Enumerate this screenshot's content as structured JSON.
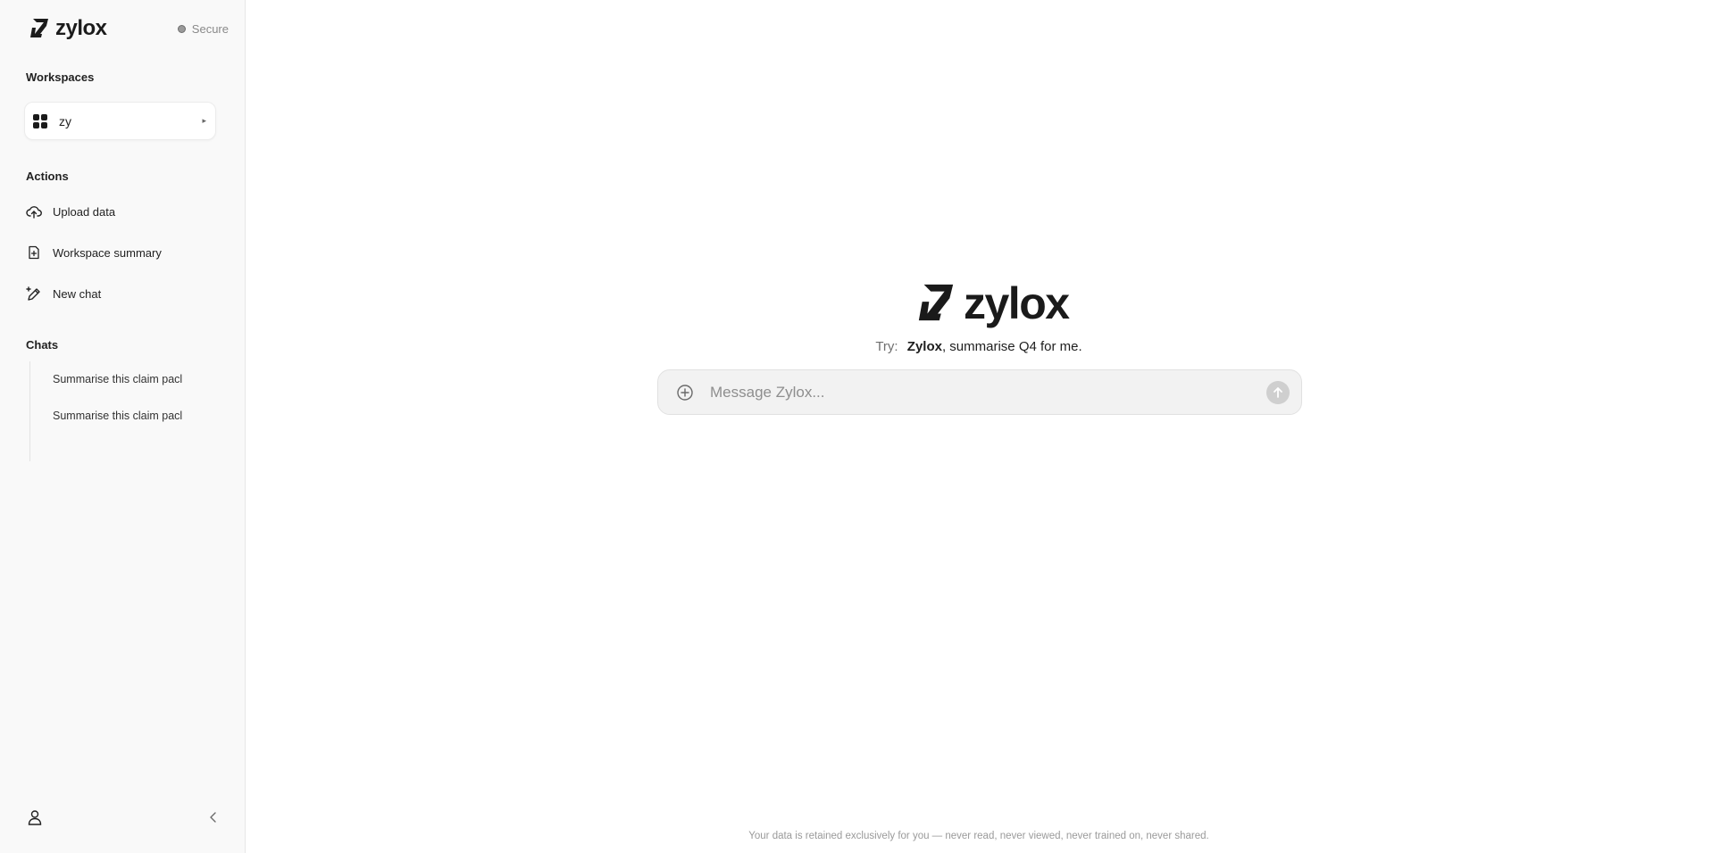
{
  "brand": {
    "name": "zylox"
  },
  "status": {
    "label": "Secure"
  },
  "sidebar": {
    "workspaces_label": "Workspaces",
    "workspace": {
      "name": "zy"
    },
    "actions_label": "Actions",
    "actions": [
      {
        "label": "Upload data",
        "icon": "cloud-upload-icon"
      },
      {
        "label": "Workspace summary",
        "icon": "file-plus-icon"
      },
      {
        "label": "New chat",
        "icon": "pen-sparkle-icon"
      }
    ],
    "chats_label": "Chats",
    "chats": [
      {
        "label": "Summarise this claim pacl"
      },
      {
        "label": "Summarise this claim pacl"
      }
    ]
  },
  "main": {
    "hero_name": "zylox",
    "try": {
      "label": "Try:",
      "brand": "Zylox",
      "rest": ", summarise Q4 for me."
    },
    "composer": {
      "placeholder": "Message Zylox..."
    },
    "footer": "Your data is retained exclusively for you — never read, never viewed, never trained on, never shared."
  },
  "colors": {
    "sidebar_bg": "#f9f9f9",
    "composer_bg": "#f2f2f2",
    "send_button": "#cfcfcf"
  }
}
